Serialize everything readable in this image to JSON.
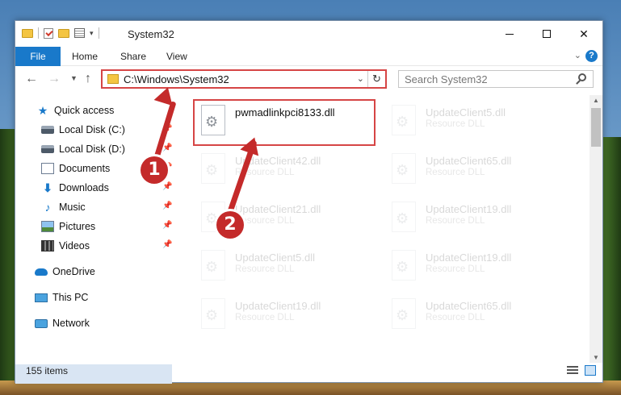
{
  "window": {
    "title": "System32"
  },
  "ribbon": {
    "tabs": [
      "File",
      "Home",
      "Share",
      "View"
    ],
    "help": "?"
  },
  "nav": {
    "address": "C:\\Windows\\System32",
    "search_placeholder": "Search System32"
  },
  "sidebar": {
    "items": [
      {
        "label": "Quick access",
        "icon": "star-icon"
      },
      {
        "label": "Local Disk (C:)",
        "icon": "disk-icon",
        "pinned": true
      },
      {
        "label": "Local Disk (D:)",
        "icon": "disk-icon",
        "pinned": true
      },
      {
        "label": "Documents",
        "icon": "documents-icon",
        "pinned": true
      },
      {
        "label": "Downloads",
        "icon": "downloads-icon",
        "pinned": true
      },
      {
        "label": "Music",
        "icon": "music-icon",
        "pinned": true
      },
      {
        "label": "Pictures",
        "icon": "pictures-icon",
        "pinned": true
      },
      {
        "label": "Videos",
        "icon": "videos-icon",
        "pinned": true
      },
      {
        "label": "OneDrive",
        "icon": "cloud-icon"
      },
      {
        "label": "This PC",
        "icon": "pc-icon",
        "selected": true
      },
      {
        "label": "Network",
        "icon": "network-icon"
      }
    ]
  },
  "files": {
    "highlighted": {
      "name": "pwmadlinkpci8133.dll",
      "type": ""
    },
    "column_left": [
      {
        "name": "UpdateClient42.dll",
        "type": "Resource DLL"
      },
      {
        "name": "UpdateClient21.dll",
        "type": "Resource DLL"
      },
      {
        "name": "UpdateClient5.dll",
        "type": "Resource DLL"
      },
      {
        "name": "UpdateClient19.dll",
        "type": "Resource DLL"
      }
    ],
    "column_right": [
      {
        "name": "UpdateClient5.dll",
        "type": "Resource DLL"
      },
      {
        "name": "UpdateClient65.dll",
        "type": "Resource DLL"
      },
      {
        "name": "UpdateClient19.dll",
        "type": "Resource DLL"
      },
      {
        "name": "UpdateClient19.dll",
        "type": "Resource DLL"
      },
      {
        "name": "UpdateClient65.dll",
        "type": "Resource DLL"
      }
    ]
  },
  "status": {
    "count": "155 items"
  },
  "annotations": {
    "step1": "1",
    "step2": "2",
    "color": "#c42a2a"
  }
}
